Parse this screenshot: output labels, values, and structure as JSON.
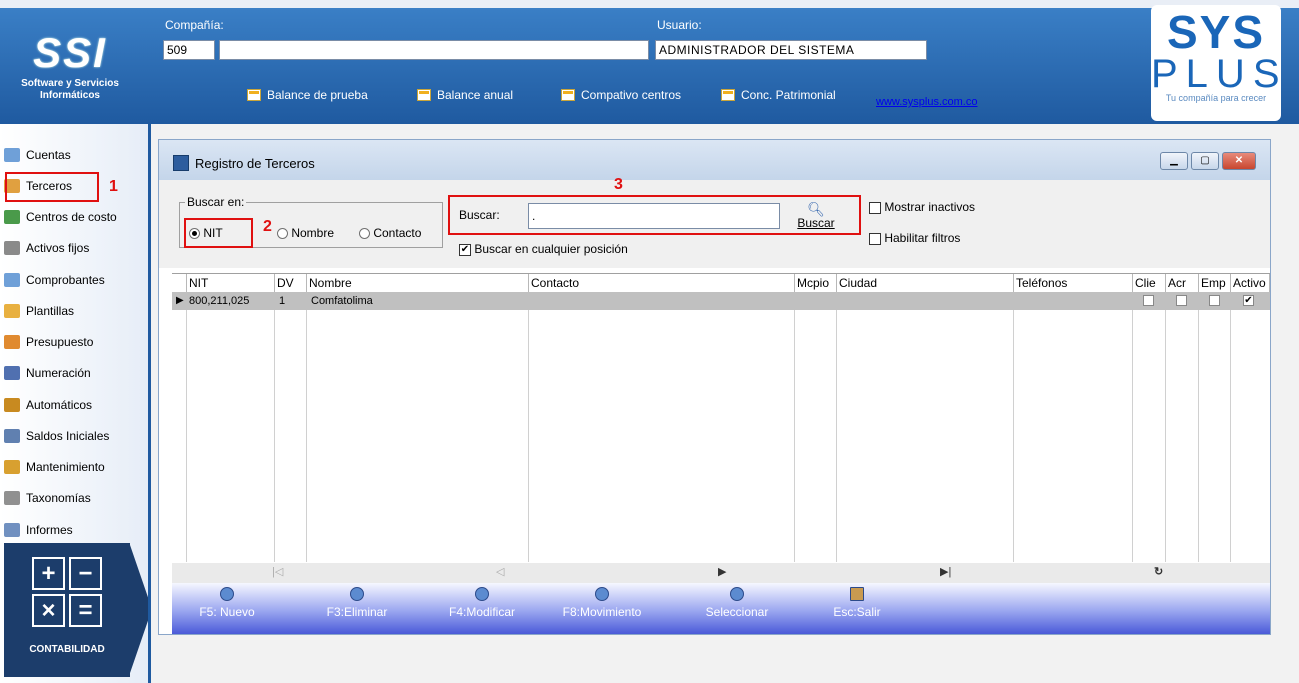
{
  "header": {
    "company_label": "Compañía:",
    "company_code": "509",
    "company_name": "",
    "user_label": "Usuario:",
    "user_value": "ADMINISTRADOR DEL SISTEMA",
    "ssi_logo_text": "SSI",
    "ssi_subtitle": "Software y Servicios Informáticos",
    "links": [
      "Balance de prueba",
      "Balance anual",
      "Compativo centros",
      "Conc. Patrimonial"
    ],
    "website": "www.sysplus.com.co",
    "sys_logo_1": "SYS",
    "sys_logo_2": "PLUS",
    "sys_tagline": "Tu compañía para crecer"
  },
  "sidebar": {
    "items": [
      {
        "label": "Cuentas",
        "icon": "table-icon",
        "color": "#6fa0d8"
      },
      {
        "label": "Terceros",
        "icon": "users-icon",
        "color": "#e0a040"
      },
      {
        "label": "Centros de costo",
        "icon": "org-chart-icon",
        "color": "#4a9a4a"
      },
      {
        "label": "Activos fijos",
        "icon": "building-icon",
        "color": "#8a8a8a"
      },
      {
        "label": "Comprobantes",
        "icon": "document-icon",
        "color": "#6fa0d8"
      },
      {
        "label": "Plantillas",
        "icon": "template-icon",
        "color": "#e8b040"
      },
      {
        "label": "Presupuesto",
        "icon": "budget-icon",
        "color": "#e08a30"
      },
      {
        "label": "Numeración",
        "icon": "list-icon",
        "color": "#5070b0"
      },
      {
        "label": "Automáticos",
        "icon": "wand-icon",
        "color": "#c88a20"
      },
      {
        "label": "Saldos Iniciales",
        "icon": "balance-icon",
        "color": "#6080b0"
      },
      {
        "label": "Mantenimiento",
        "icon": "gear-icon",
        "color": "#d8a030"
      },
      {
        "label": "Taxonomías",
        "icon": "sigma-icon",
        "color": "#909090"
      },
      {
        "label": "Informes",
        "icon": "printer-icon",
        "color": "#7090c0"
      }
    ],
    "contab_label": "CONTABILIDAD",
    "contab_symbols": [
      "+",
      "−",
      "×",
      "="
    ]
  },
  "window": {
    "title": "Registro de Terceros",
    "buscar_en_label": "Buscar en:",
    "radio_nit": "NIT",
    "radio_nombre": "Nombre",
    "radio_contacto": "Contacto",
    "buscar_label": "Buscar:",
    "buscar_value": ".",
    "buscar_button": "Buscar",
    "any_position_label": "Buscar en cualquier posición",
    "mostrar_inactivos": "Mostrar inactivos",
    "habilitar_filtros": "Habilitar filtros",
    "annotations": [
      "1",
      "2",
      "3"
    ]
  },
  "grid": {
    "headers": [
      "NIT",
      "DV",
      "Nombre",
      "Contacto",
      "Mcpio",
      "Ciudad",
      "Teléfonos",
      "Clie",
      "Acr",
      "Emp",
      "Activo"
    ],
    "rows": [
      {
        "nit": "800,211,025",
        "dv": "1",
        "nombre": "Comfatolima",
        "contacto": "",
        "mcpio": "",
        "ciudad": "",
        "telefonos": "",
        "clie": false,
        "acr": false,
        "emp": false,
        "activo": true
      }
    ]
  },
  "toolbar": {
    "buttons": [
      "F5: Nuevo",
      "F3:Eliminar",
      "F4:Modificar",
      "F8:Movimiento",
      "Seleccionar",
      "Esc:Salir"
    ]
  },
  "colors": {
    "header_blue": "#2c6fb7",
    "annotation_red": "#e01010",
    "contab_navy": "#1c3d6b"
  }
}
